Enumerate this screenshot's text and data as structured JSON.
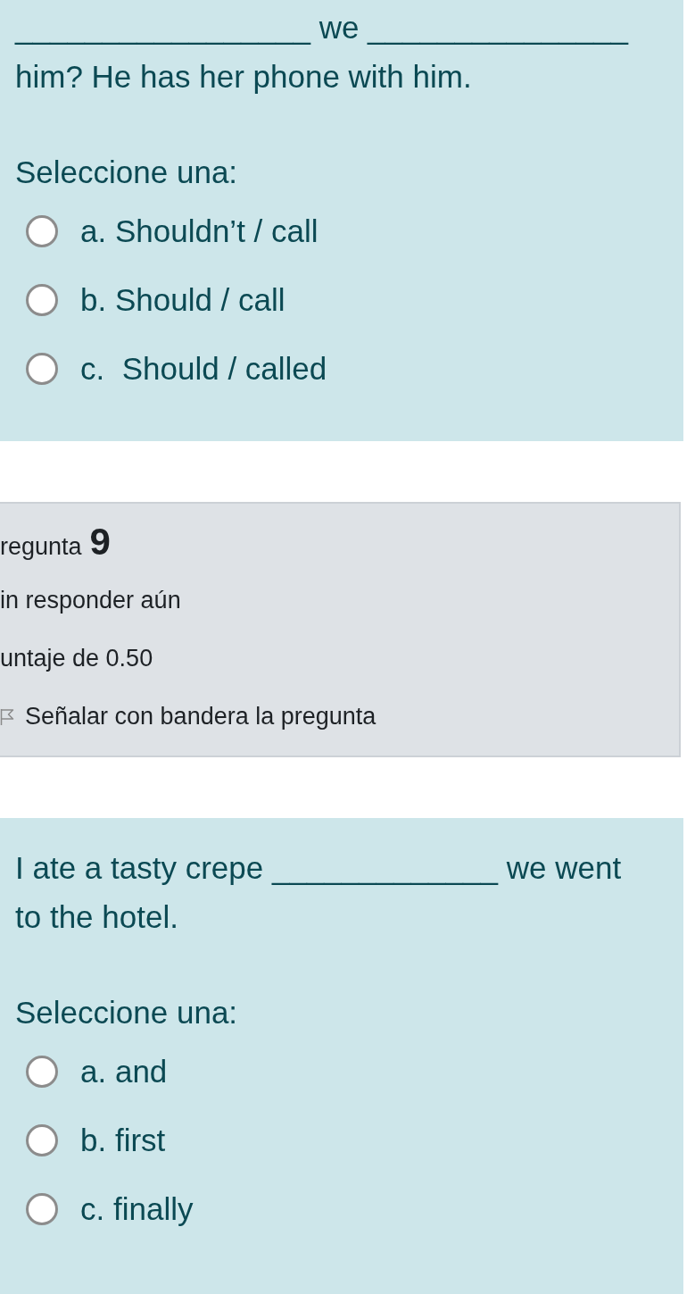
{
  "question_8": {
    "text": "_________________ we _______________ him? He has her phone with him.",
    "prompt": "Seleccione una:",
    "options": [
      {
        "label": "a. Shouldn’t / call",
        "selected": false
      },
      {
        "label": "b. Should / call",
        "selected": false
      },
      {
        "label": "c.  Should / called",
        "selected": false
      }
    ]
  },
  "question_9": {
    "info": {
      "title": "regunta",
      "number": "9",
      "status": "in responder aún",
      "points": "untaje de 0.50",
      "flag": {
        "label": "Señalar con bandera la pregunta",
        "flagged": false
      }
    },
    "text": "I ate a tasty crepe _____________ we went to the hotel.",
    "prompt": "Seleccione una:",
    "options": [
      {
        "label": "a. and",
        "selected": false
      },
      {
        "label": "b. first",
        "selected": false
      },
      {
        "label": "c. finally",
        "selected": false
      }
    ]
  }
}
